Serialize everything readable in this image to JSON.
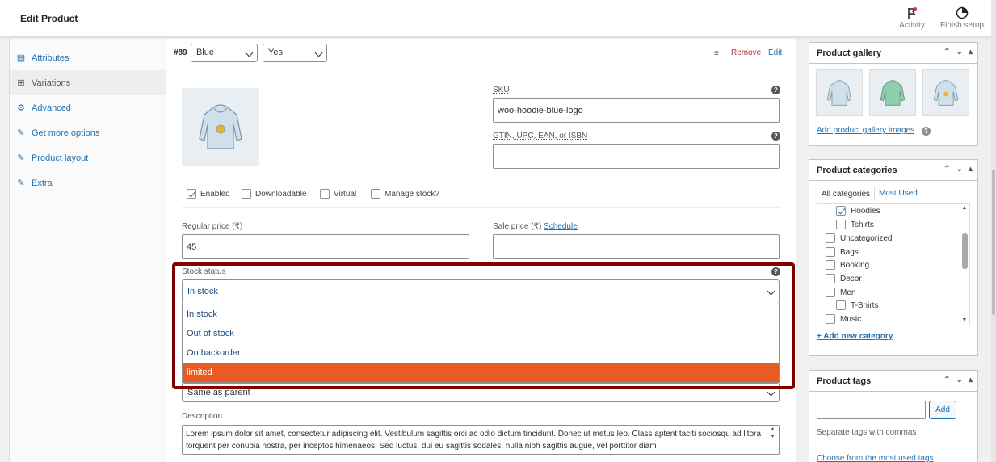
{
  "header": {
    "title": "Edit Product",
    "activity_label": "Activity",
    "finish_setup_label": "Finish setup"
  },
  "sidebar": {
    "items": [
      {
        "label": "Attributes",
        "icon": "list-icon"
      },
      {
        "label": "Variations",
        "icon": "grid-icon"
      },
      {
        "label": "Advanced",
        "icon": "gear-icon"
      },
      {
        "label": "Get more options",
        "icon": "plug-icon"
      },
      {
        "label": "Product layout",
        "icon": "wrench-icon"
      },
      {
        "label": "Extra",
        "icon": "wrench-icon"
      }
    ],
    "active": "Variations"
  },
  "variation": {
    "id": "#89",
    "color_select": "Blue",
    "yes_select": "Yes",
    "remove_label": "Remove",
    "edit_label": "Edit",
    "sku_label": "SKU",
    "sku_value": "woo-hoodie-blue-logo",
    "gtin_label": "GTIN, UPC, EAN, or ISBN",
    "gtin_value": "",
    "checkboxes": [
      {
        "label": "Enabled",
        "checked": true
      },
      {
        "label": "Downloadable",
        "checked": false
      },
      {
        "label": "Virtual",
        "checked": false
      },
      {
        "label": "Manage stock?",
        "checked": false
      }
    ],
    "regular_price_label": "Regular price (₹)",
    "regular_price_value": "45",
    "sale_price_label": "Sale price (₹)",
    "schedule_label": "Schedule",
    "sale_price_value": "",
    "stock_status_label": "Stock status",
    "stock_status_value": "In stock",
    "stock_options": [
      "In stock",
      "Out of stock",
      "On backorder",
      "limited"
    ],
    "highlighted_option": "limited",
    "shipping_value": "Same as parent",
    "description_label": "Description",
    "description_value": "Lorem ipsum dolor sit amet, consectetur adipiscing elit. Vestibulum sagittis orci ac odio dictum tincidunt. Donec ut metus leo. Class aptent taciti sociosqu ad litora torquent per conubia nostra, per inceptos himenaeos. Sed luctus, dui eu sagittis sodales, nulla nibh sagittis augue, vel porttitor diam"
  },
  "gallery": {
    "title": "Product gallery",
    "add_link": "Add product gallery images"
  },
  "categories": {
    "title": "Product categories",
    "tab_all": "All categories",
    "tab_most": "Most Used",
    "items": [
      {
        "label": "Hoodies",
        "checked": true,
        "child": true
      },
      {
        "label": "Tshirts",
        "checked": false,
        "child": true
      },
      {
        "label": "Uncategorized",
        "checked": false,
        "child": false
      },
      {
        "label": "Bags",
        "checked": false,
        "child": false
      },
      {
        "label": "Booking",
        "checked": false,
        "child": false
      },
      {
        "label": "Decor",
        "checked": false,
        "child": false
      },
      {
        "label": "Men",
        "checked": false,
        "child": false
      },
      {
        "label": "T-Shirts",
        "checked": false,
        "child": true
      },
      {
        "label": "Music",
        "checked": false,
        "child": false
      }
    ],
    "add_link": "+ Add new category"
  },
  "tags": {
    "title": "Product tags",
    "input_value": "",
    "add_button": "Add",
    "hint": "Separate tags with commas",
    "choose_link": "Choose from the most used tags"
  },
  "colors": {
    "accent": "#2271b1",
    "highlight_border": "#800000",
    "option_highlight": "#e85b22",
    "remove": "#b32d2e"
  }
}
